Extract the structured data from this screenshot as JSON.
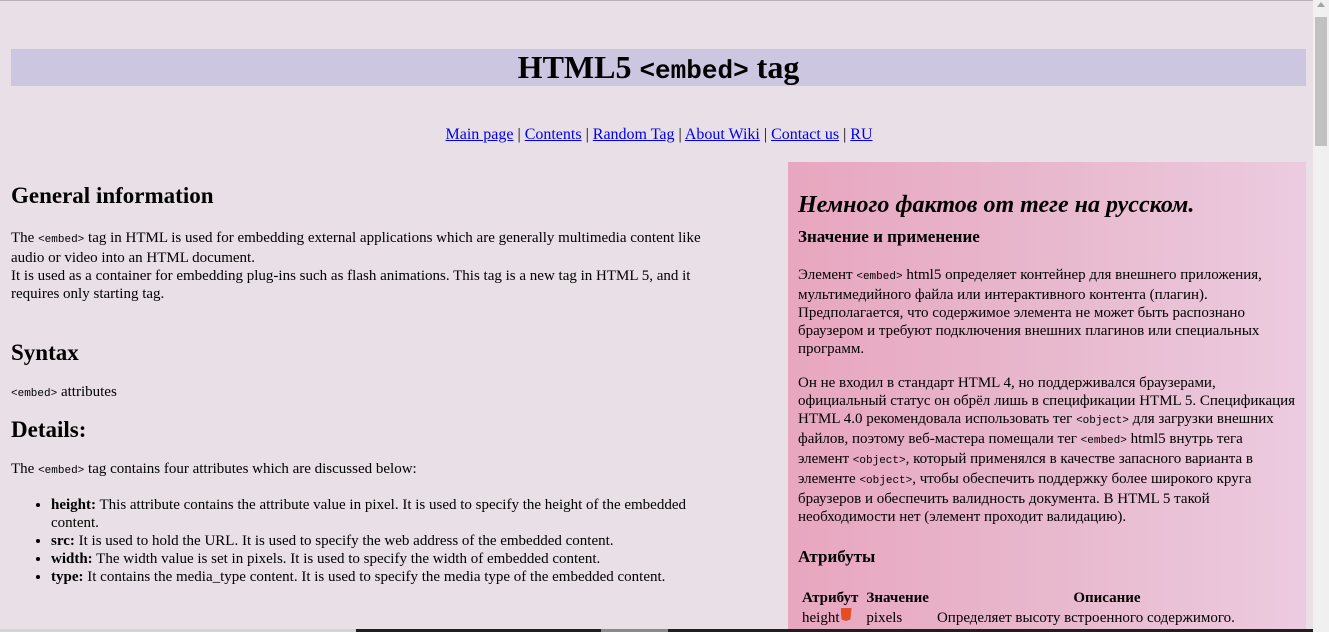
{
  "header": {
    "title_text": "HTML5",
    "title_tag": "<embed>",
    "title_suffix": "tag"
  },
  "nav": {
    "links": [
      "Main page",
      "Contents",
      "Random Tag",
      "About Wiki",
      "Contact us",
      "RU"
    ],
    "separator": "|"
  },
  "general": {
    "heading": "General information",
    "p1_pre": "The",
    "p1_code": "<embed>",
    "p1_post": "tag in HTML is used for embedding external applications which are generally multimedia content like audio or video into an HTML document.",
    "p2": "It is used as a container for embedding plug-ins such as flash animations. This tag is a new tag in HTML 5, and it requires only starting tag."
  },
  "syntax": {
    "heading": "Syntax",
    "code": "<embed>",
    "text": "attributes"
  },
  "details": {
    "heading": "Details:",
    "intro_pre": "The",
    "intro_code": "<embed>",
    "intro_post": "tag contains four attributes which are discussed below:",
    "items": [
      {
        "term": "height:",
        "desc": "This attribute contains the attribute value in pixel. It is used to specify the height of the embedded content."
      },
      {
        "term": "src:",
        "desc": "It is used to hold the URL. It is used to specify the web address of the embedded content."
      },
      {
        "term": "width:",
        "desc": "The width value is set in pixels. It is used to specify the width of embedded content."
      },
      {
        "term": "type:",
        "desc": "It contains the media_type content. It is used to specify the media type of the embedded content."
      }
    ]
  },
  "russian": {
    "heading": "Немного фактов от теге на русском.",
    "sub1": "Значение и применение",
    "p1_pre": "Элемент",
    "p1_code": "<embed>",
    "p1_post": "html5 определяет контейнер для внешнего приложения, мультимедийного файла или интерактивного контента (плагин). Предполагается, что содержимое элемента не может быть распознано браузером и требуют подключения внешних плагинов или специальных программ.",
    "p2_a": "Он не входил в стандарт HTML 4, но поддерживался браузерами, официальный статус он обрёл лишь в спецификации HTML 5. Спецификация HTML 4.0 рекомендовала использовать тег",
    "p2_code1": "<object>",
    "p2_b": "для загрузки внешних файлов, поэтому веб-мастера помещали тег",
    "p2_code2": "<embed>",
    "p2_c": "html5 внутрь тега элемент",
    "p2_code3": "<object>",
    "p2_d": ", который применялся в качестве запасного варианта в элементе",
    "p2_code4": "<object>",
    "p2_e": ", чтобы обеспечить поддержку более широкого круга браузеров и обеспечить валидность документа. В HTML 5 такой необходимости нет (элемент проходит валидацию).",
    "sub2": "Атрибуты",
    "table": {
      "headers": [
        "Атрибут",
        "Значение",
        "Описание"
      ],
      "rows": [
        [
          "height",
          "pixels",
          "Определяет высоту встроенного содержимого."
        ]
      ]
    }
  },
  "colors": {
    "page_bg": "#e9dfe6",
    "title_bar_bg": "#ccc6e0",
    "link": "#0000ee",
    "side_panel_left": "#e8a6bf",
    "side_panel_right": "#eccbe0",
    "html5_badge": "#e44d26"
  }
}
